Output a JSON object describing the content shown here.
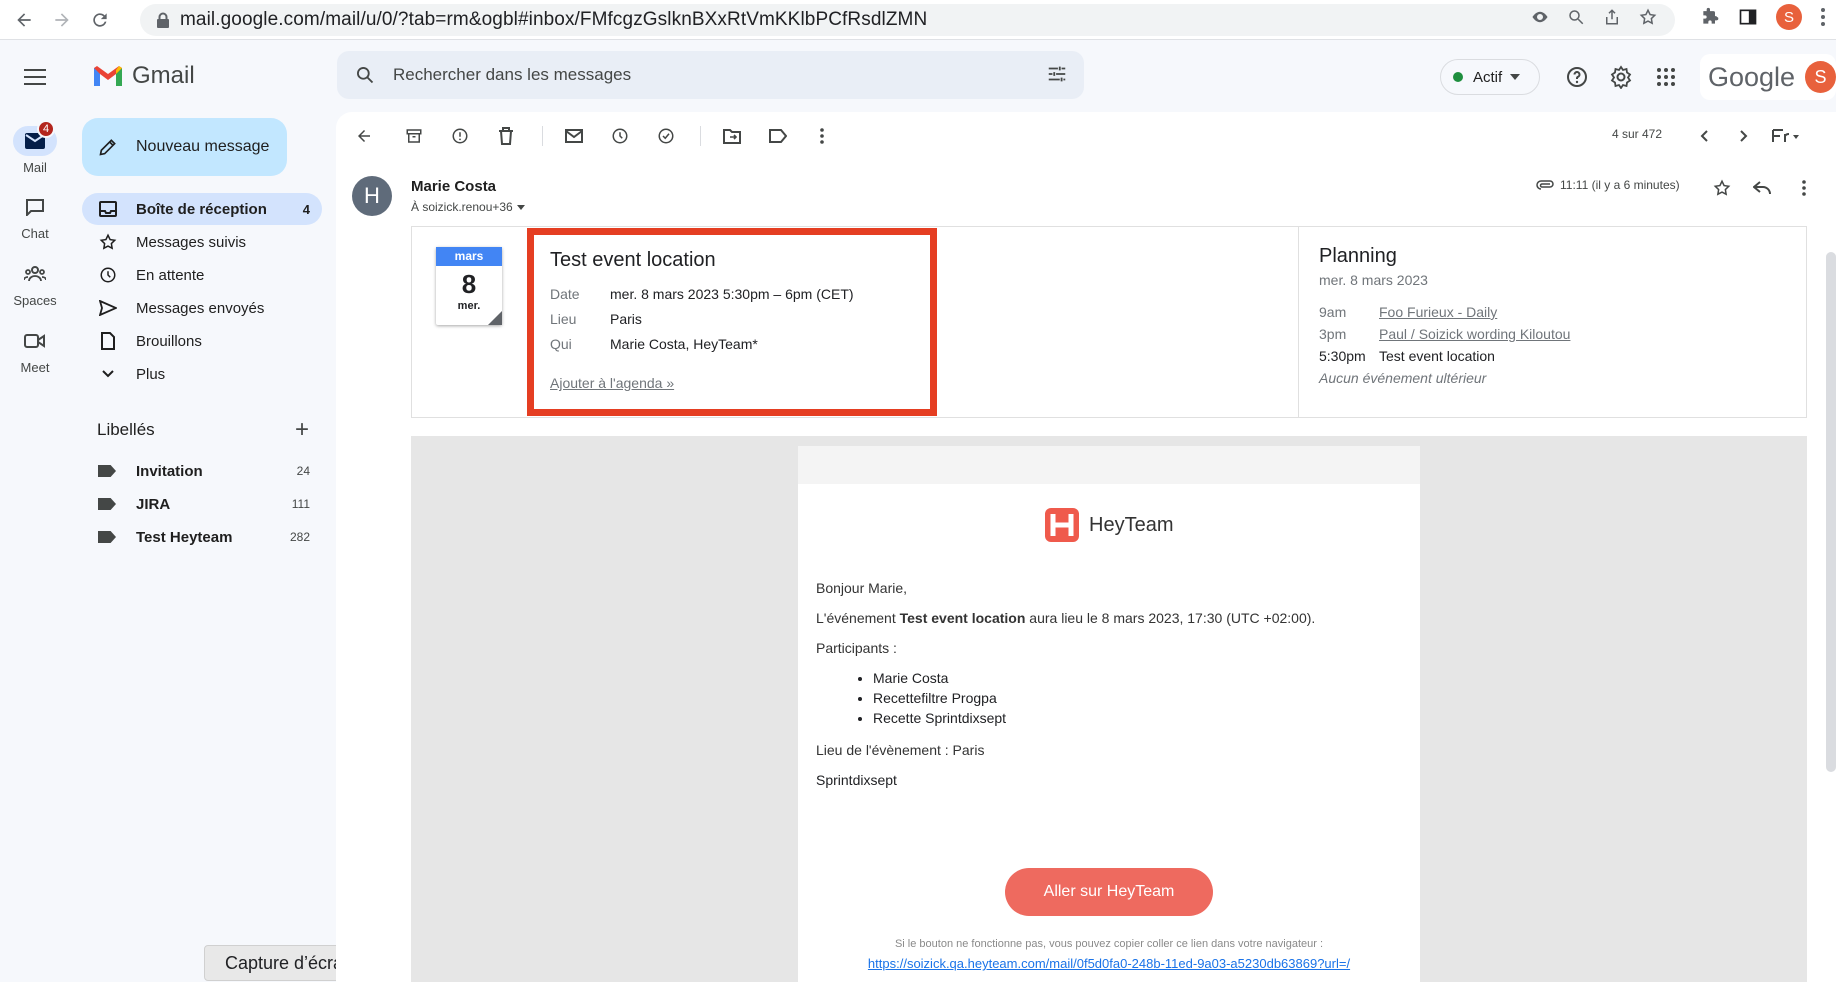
{
  "browser": {
    "url": "mail.google.com/mail/u/0/?tab=rm&ogbl#inbox/FMfcgzGslknBXxRtVmKKlbPCfRsdlZMN",
    "profile_initial": "S"
  },
  "header": {
    "app_name": "Gmail",
    "search_placeholder": "Rechercher dans les messages",
    "status": "Actif",
    "google_wordmark": "Google",
    "avatar_initial": "S"
  },
  "rail": {
    "items": [
      {
        "label": "Mail",
        "badge": "4"
      },
      {
        "label": "Chat"
      },
      {
        "label": "Spaces"
      },
      {
        "label": "Meet"
      }
    ]
  },
  "sidebar": {
    "compose_label": "Nouveau message",
    "items": [
      {
        "label": "Boîte de réception",
        "count": "4"
      },
      {
        "label": "Messages suivis"
      },
      {
        "label": "En attente"
      },
      {
        "label": "Messages envoyés"
      },
      {
        "label": "Brouillons"
      },
      {
        "label": "Plus"
      }
    ],
    "labels_title": "Libellés",
    "labels": [
      {
        "label": "Invitation",
        "count": "24"
      },
      {
        "label": "JIRA",
        "count": "111"
      },
      {
        "label": "Test Heyteam",
        "count": "282"
      }
    ],
    "screenshot_chip": "Capture d’écran"
  },
  "toolbar": {
    "pager": "4 sur 472"
  },
  "message": {
    "sender_initial": "H",
    "sender_name": "Marie Costa",
    "to": "À soizick.renou+36",
    "time": "11:11 (il y a 6 minutes)"
  },
  "invitation": {
    "month": "mars",
    "day": "8",
    "weekday": "mer.",
    "title": "Test event location",
    "rows": [
      {
        "key": "Date",
        "value": "mer. 8 mars 2023 5:30pm – 6pm (CET)"
      },
      {
        "key": "Lieu",
        "value": "Paris"
      },
      {
        "key": "Qui",
        "value": "Marie Costa, HeyTeam*"
      }
    ],
    "add_link": "Ajouter à l'agenda »",
    "planning": {
      "title": "Planning",
      "date": "mer. 8 mars 2023",
      "events": [
        {
          "time": "9am",
          "name": "Foo Furieux - Daily"
        },
        {
          "time": "3pm",
          "name": "Paul / Soizick wording Kiloutou"
        },
        {
          "time": "5:30pm",
          "name": "Test event location"
        }
      ],
      "none": "Aucun événement ultérieur"
    }
  },
  "email": {
    "brand": "HeyTeam",
    "greeting": "Bonjour Marie,",
    "line_prefix": "L'événement",
    "event_name": "Test event location",
    "line_suffix": "aura lieu le 8 mars 2023, 17:30 (UTC +02:00).",
    "participants_label": "Participants :",
    "participants": [
      "Marie Costa",
      "Recettefiltre Progpa",
      "Recette Sprintdixsept"
    ],
    "location_line": "Lieu de l'évènement : Paris",
    "extra_line": "Sprintdixsept",
    "cta": "Aller sur HeyTeam",
    "fallback": "Si le bouton ne fonctionne pas, vous pouvez copier coller ce lien dans votre navigateur :",
    "fallback_link": "https://soizick.qa.heyteam.com/mail/0f5d0fa0-248b-11ed-9a03-a5230db63869?url=/"
  },
  "colors": {
    "highlight_border": "#e53e22",
    "compose_bg": "#c2e7ff",
    "active_nav": "#d3e3fd",
    "cta": "#ee6a5f"
  }
}
